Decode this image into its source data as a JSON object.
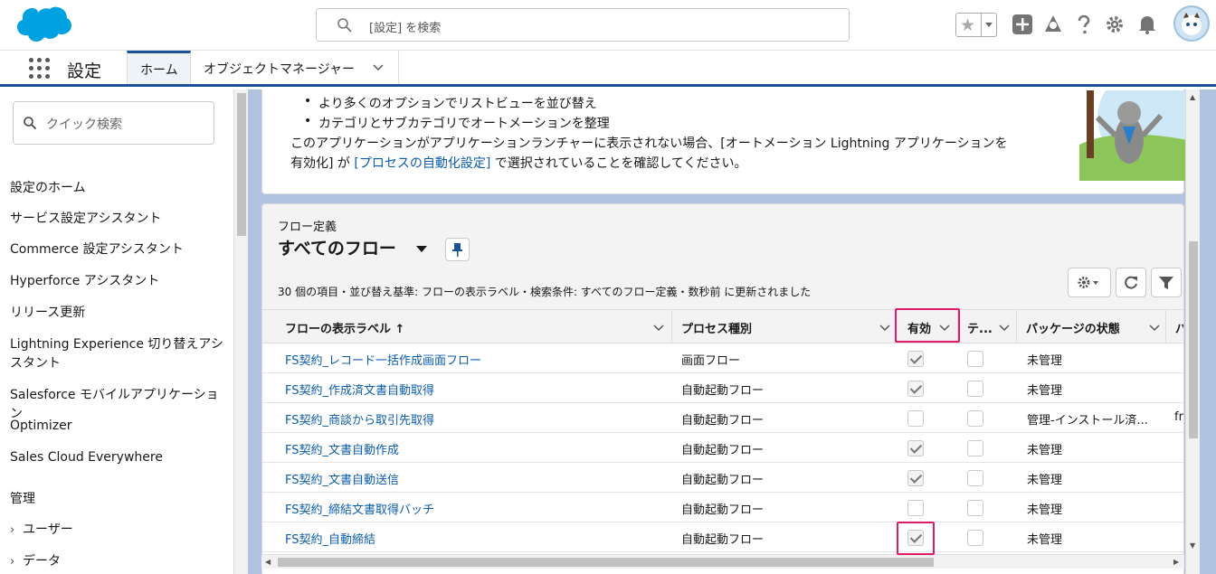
{
  "header": {
    "search_placeholder": "[設定] を検索"
  },
  "nav": {
    "app_name": "設定",
    "tabs": [
      {
        "label": "ホーム"
      },
      {
        "label": "オブジェクトマネージャー"
      }
    ]
  },
  "sidebar": {
    "quick_search_placeholder": "クイック検索",
    "items": [
      "設定のホーム",
      "サービス設定アシスタント",
      "Commerce 設定アシスタント",
      "Hyperforce アシスタント",
      "リリース更新",
      "Lightning Experience 切り替えアシスタント",
      "Salesforce モバイルアプリケーション",
      "Optimizer",
      "Sales Cloud Everywhere"
    ],
    "group_label": "管理",
    "expandables": [
      "ユーザー",
      "データ"
    ]
  },
  "intro": {
    "bullets": [
      "より多くのオプションでリストビューを並び替え",
      "カテゴリとサブカテゴリでオートメーションを整理"
    ],
    "note_line1": "このアプリケーションがアプリケーションランチャーに表示されない場合、[オートメーション Lightning アプリケーションを",
    "note_line2_pre": "有効化] が ",
    "note_link": "[プロセスの自動化設定]",
    "note_line2_post": " で選択されていることを確認してください。"
  },
  "list_view": {
    "eyebrow": "フロー定義",
    "title": "すべてのフロー",
    "meta": "30 個の項目・並び替え基準: フローの表示ラベル・検索条件: すべてのフロー定義・数秒前 に更新されました",
    "columns": {
      "label": "フローの表示ラベル ↑",
      "process": "プロセス種別",
      "active": "有効",
      "template": "テ...",
      "package": "パッケージの状態",
      "extra": "パッ"
    },
    "rows": [
      {
        "label": "FS契約_レコード一括作成画面フロー",
        "process": "画面フロー",
        "active": true,
        "template": false,
        "package": "未管理",
        "extra": ""
      },
      {
        "label": "FS契約_作成済文書自動取得",
        "process": "自動起動フロー",
        "active": true,
        "template": false,
        "package": "未管理",
        "extra": ""
      },
      {
        "label": "FS契約_商談から取引先取得",
        "process": "自動起動フロー",
        "active": false,
        "template": false,
        "package": "管理-インストール済...",
        "extra": "fr"
      },
      {
        "label": "FS契約_文書自動作成",
        "process": "自動起動フロー",
        "active": true,
        "template": false,
        "package": "未管理",
        "extra": ""
      },
      {
        "label": "FS契約_文書自動送信",
        "process": "自動起動フロー",
        "active": true,
        "template": false,
        "package": "未管理",
        "extra": ""
      },
      {
        "label": "FS契約_締結文書取得バッチ",
        "process": "自動起動フロー",
        "active": false,
        "template": false,
        "package": "未管理",
        "extra": ""
      },
      {
        "label": "FS契約_自動締結",
        "process": "自動起動フロー",
        "active": true,
        "template": false,
        "package": "未管理",
        "extra": ""
      }
    ]
  },
  "colors": {
    "brand": "#1b5297",
    "link": "#0b5cab",
    "highlight": "#e0196b",
    "background": "#b0c4df"
  }
}
